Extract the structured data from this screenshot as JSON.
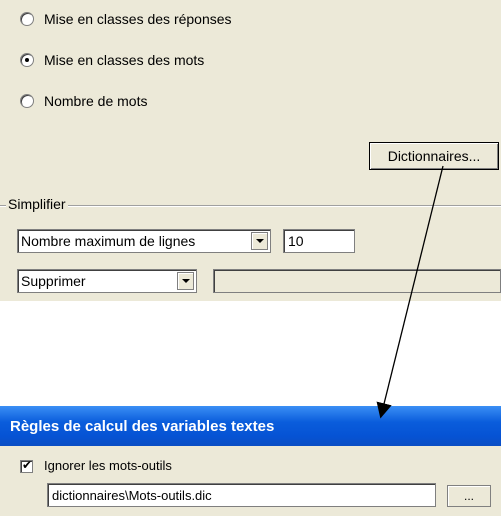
{
  "analysis_options": {
    "radios": [
      {
        "label": "Mise en classes des réponses",
        "checked": false
      },
      {
        "label": "Mise en classes des mots",
        "checked": true
      },
      {
        "label": "Nombre de mots",
        "checked": false
      }
    ],
    "dictionaries_button_label": "Dictionnaires..."
  },
  "simplify": {
    "group_label": "Simplifier",
    "mode_select_value": "Nombre maximum de lignes",
    "count_value": "10",
    "action_select_value": "Supprimer",
    "action_text_value": ""
  },
  "dialog": {
    "title": "Règles de calcul des variables textes",
    "ignore_stopwords_label": "Ignorer les mots-outils",
    "ignore_stopwords_checked": true,
    "dictionary_path": "dictionnaires\\Mots-outils.dic",
    "browse_button_label": "..."
  }
}
